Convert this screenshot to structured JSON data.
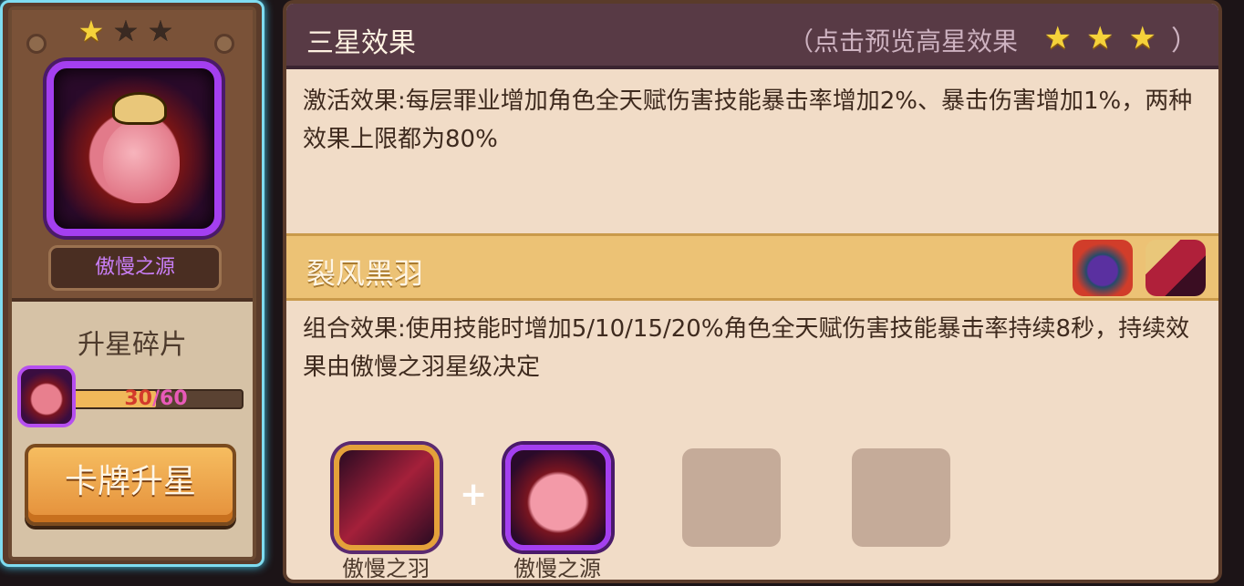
{
  "card": {
    "stars": [
      true,
      false,
      false
    ],
    "name": "傲慢之源",
    "shards_title": "升星碎片",
    "progress_current": "30",
    "progress_max": "/60",
    "progress_fraction": 0.5,
    "upgrade_button": "卡牌升星"
  },
  "panel": {
    "title": "三星效果",
    "preview_hint": "（点击预览高星效果",
    "paren_close": "）",
    "effect_text": "激活效果:每层罪业增加角色全天赋伤害技能暴击率增加2%、暴击伤害增加1%，两种效果上限都为80%",
    "combo_title": "裂风黑羽",
    "combo_text": "组合效果:使用技能时增加5/10/15/20%角色全天赋伤害技能暴击率持续8秒，持续效果由傲慢之羽星级决定",
    "combo_items": [
      {
        "label": "傲慢之羽",
        "icon": "feather-card-icon"
      },
      {
        "label": "傲慢之源",
        "icon": "source-card-icon"
      }
    ],
    "plus": "+"
  },
  "icons": {
    "star_on": "★",
    "star_off": "★"
  },
  "colors": {
    "star_gold": "#f5d23a",
    "frame_cyan": "#7fdcf0",
    "purple_rarity": "#a43ff0",
    "header_bg": "#583a45",
    "combo_bar": "#ecc275"
  }
}
